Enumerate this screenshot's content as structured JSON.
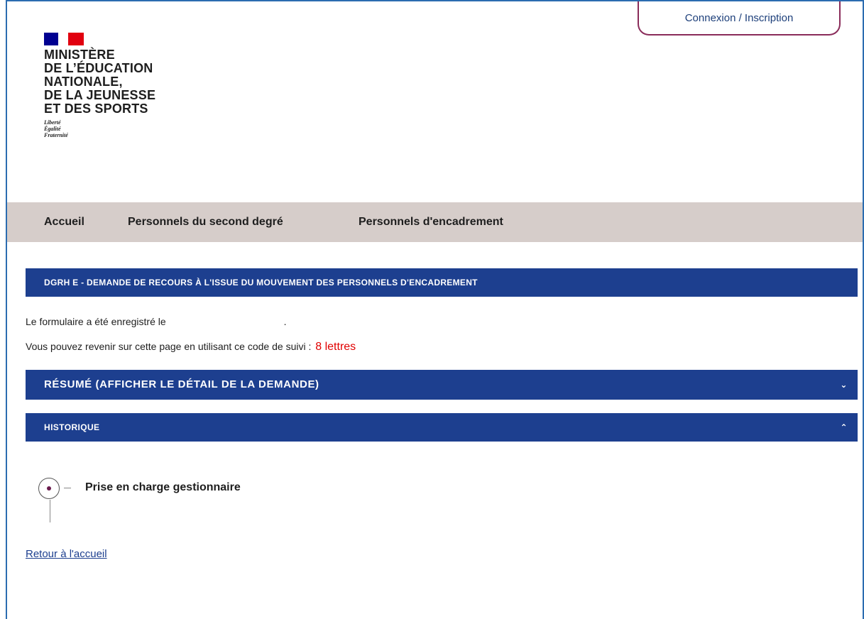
{
  "header": {
    "login_label": "Connexion / Inscription",
    "ministry_lines": [
      "MINISTÈRE",
      "DE L’ÉDUCATION",
      "NATIONALE,",
      "DE LA JEUNESSE",
      "ET DES SPORTS"
    ],
    "motto": [
      "Liberté",
      "Égalité",
      "Fraternité"
    ]
  },
  "nav": {
    "items": [
      "Accueil",
      "Personnels du second degré",
      "Personnels d'encadrement"
    ]
  },
  "form": {
    "title": "DGRH E - DEMANDE DE RECOURS À L'ISSUE DU MOUVEMENT DES PERSONNELS D'ENCADREMENT",
    "saved_text": "Le formulaire a été enregistré le",
    "saved_suffix": ".",
    "tracking_text": "Vous pouvez revenir sur cette page en utilisant ce code de suivi :",
    "tracking_annotation": "8 lettres"
  },
  "panels": {
    "resume_label": "RÉSUMÉ (AFFICHER LE DÉTAIL DE LA DEMANDE)",
    "resume_chevron": "⌄",
    "historique_label": "HISTORIQUE",
    "historique_chevron": "⌃"
  },
  "history": {
    "steps": [
      {
        "label": "Prise en charge gestionnaire"
      }
    ]
  },
  "footer": {
    "back_link": "Retour à l'accueil"
  },
  "colors": {
    "primary_bar": "#1d3f8f",
    "nav_bg": "#d6cdca",
    "login_border": "#8a2c5a",
    "annotation": "#e10000"
  }
}
